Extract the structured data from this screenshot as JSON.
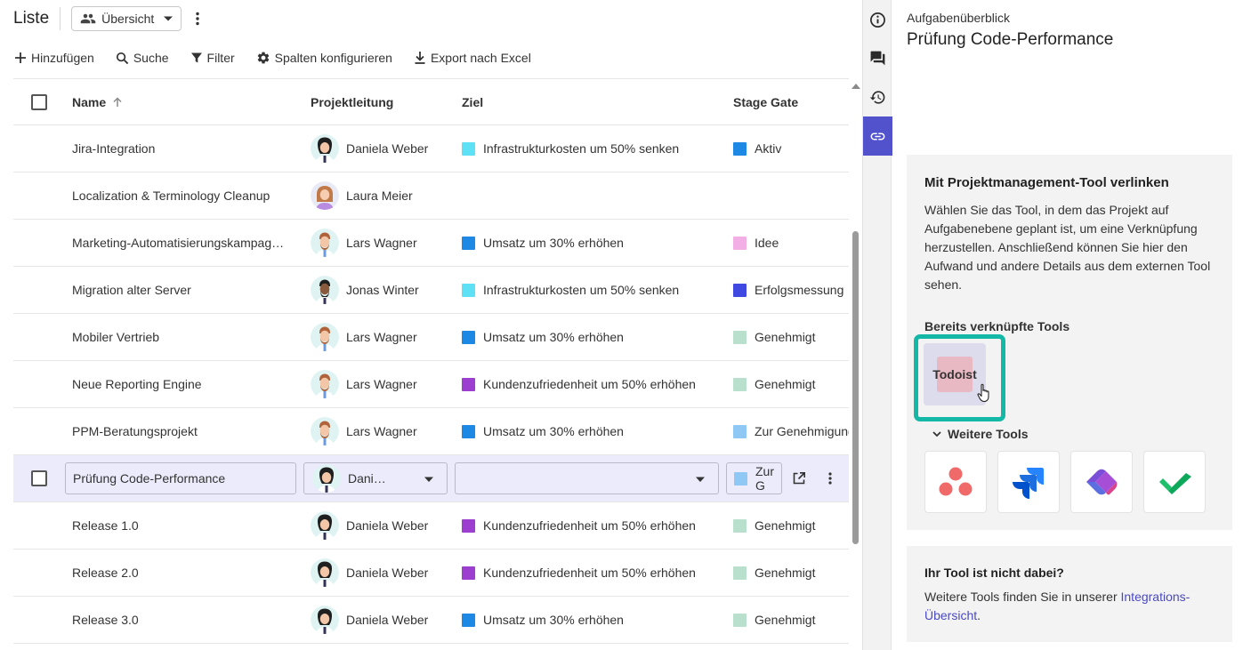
{
  "header": {
    "title": "Liste",
    "view_label": "Übersicht"
  },
  "toolbar": {
    "add": "Hinzufügen",
    "search": "Suche",
    "filter": "Filter",
    "columns": "Spalten konfigurieren",
    "export": "Export nach Excel"
  },
  "table": {
    "columns": {
      "name": "Name",
      "lead": "Projektleitung",
      "goal": "Ziel",
      "stage": "Stage Gate"
    },
    "rows": [
      {
        "name": "Jira-Integration",
        "lead": "Daniela Weber",
        "goal": "Infrastrukturkosten um 50% senken",
        "goal_color": "#5ee0f5",
        "stage": "Aktiv",
        "stage_color": "#1e88e5"
      },
      {
        "name": "Localization & Terminology Cleanup",
        "lead": "Laura Meier",
        "goal": "",
        "goal_color": "",
        "stage": "",
        "stage_color": ""
      },
      {
        "name": "Marketing-Automatisierungskampag…",
        "lead": "Lars Wagner",
        "goal": "Umsatz um 30% erhöhen",
        "goal_color": "#1e88e5",
        "stage": "Idee",
        "stage_color": "#f3aee5"
      },
      {
        "name": "Migration alter Server",
        "lead": "Jonas Winter",
        "goal": "Infrastrukturkosten um 50% senken",
        "goal_color": "#5ee0f5",
        "stage": "Erfolgsmessung",
        "stage_color": "#3f48e0"
      },
      {
        "name": "Mobiler Vertrieb",
        "lead": "Lars Wagner",
        "goal": "Umsatz um 30% erhöhen",
        "goal_color": "#1e88e5",
        "stage": "Genehmigt",
        "stage_color": "#b8e0cc"
      },
      {
        "name": "Neue Reporting Engine",
        "lead": "Lars Wagner",
        "goal": "Kundenzufriedenheit um 50% erhöhen",
        "goal_color": "#9c3fd0",
        "stage": "Genehmigt",
        "stage_color": "#b8e0cc"
      },
      {
        "name": "PPM-Beratungsprojekt",
        "lead": "Lars Wagner",
        "goal": "Umsatz um 30% erhöhen",
        "goal_color": "#1e88e5",
        "stage": "Zur Genehmigung",
        "stage_color": "#90c8f5"
      }
    ],
    "selected_row": {
      "name": "Prüfung Code-Performance",
      "lead": "Dani…",
      "goal": "",
      "stage": "Zur G",
      "stage_color": "#90c8f5"
    },
    "rows_after": [
      {
        "name": "Release 1.0",
        "lead": "Daniela Weber",
        "goal": "Kundenzufriedenheit um 50% erhöhen",
        "goal_color": "#9c3fd0",
        "stage": "Genehmigt",
        "stage_color": "#b8e0cc"
      },
      {
        "name": "Release 2.0",
        "lead": "Daniela Weber",
        "goal": "Kundenzufriedenheit um 50% erhöhen",
        "goal_color": "#9c3fd0",
        "stage": "Genehmigt",
        "stage_color": "#b8e0cc"
      },
      {
        "name": "Release 3.0",
        "lead": "Daniela Weber",
        "goal": "Umsatz um 30% erhöhen",
        "goal_color": "#1e88e5",
        "stage": "Genehmigt",
        "stage_color": "#b8e0cc"
      }
    ]
  },
  "rail": {
    "items": [
      "info-icon",
      "comments-icon",
      "history-icon",
      "link-icon"
    ],
    "active": "link-icon"
  },
  "panel": {
    "subtitle": "Aufgabenüberblick",
    "title": "Prüfung Code-Performance",
    "card_title": "Mit Projektmanagement-Tool verlinken",
    "card_text": "Wählen Sie das Tool, in dem das Projekt auf Aufgabenebene geplant ist, um eine Verknüpfung herzustellen. Anschließend können Sie hier den Aufwand und andere Details aus dem externen Tool sehen.",
    "linked_label": "Bereits verknüpfte Tools",
    "linked_tool": "Todoist",
    "more_tools_label": "Weitere Tools",
    "more_tools": [
      "asana-icon",
      "jira-icon",
      "ms-planner-icon",
      "check-tool-icon"
    ],
    "missing_title": "Ihr Tool ist nicht dabei?",
    "missing_text": "Weitere Tools finden Sie in unserer ",
    "missing_link": "Integrations-Übersicht",
    "missing_end": "."
  },
  "colors": {
    "accent": "#5252cc",
    "highlight": "#14b8a6",
    "selected_row": "#ebebfb"
  }
}
